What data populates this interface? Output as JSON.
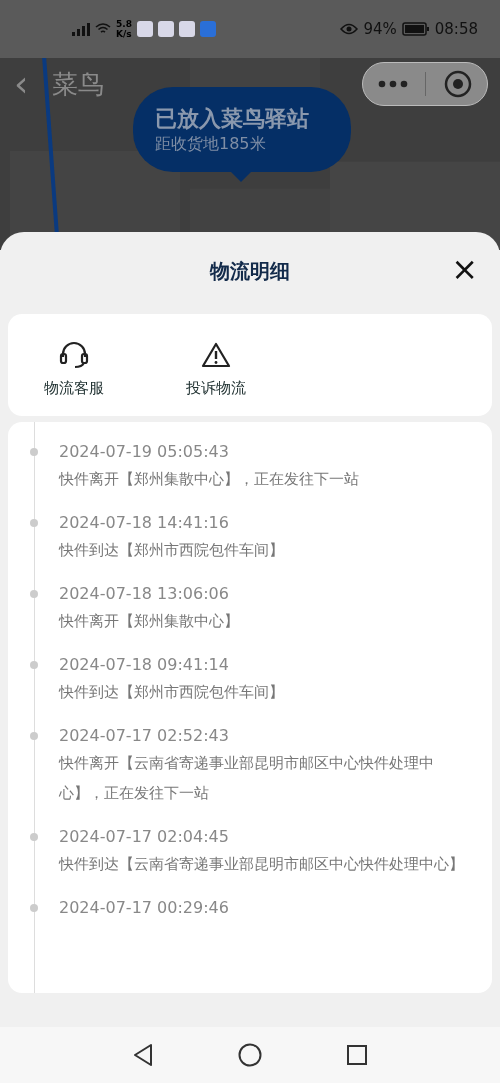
{
  "status_bar": {
    "speed": "5.8",
    "speed_unit": "K/s",
    "battery": "94%",
    "time": "08:58"
  },
  "map_header": {
    "back": "‹",
    "title": "菜鸟"
  },
  "bubble": {
    "title": "已放入菜鸟驿站",
    "subtitle": "距收货地185米"
  },
  "sheet": {
    "title": "物流明细",
    "close": "×"
  },
  "actions": [
    {
      "kind": "headset",
      "label": "物流客服"
    },
    {
      "kind": "warning",
      "label": "投诉物流"
    }
  ],
  "events": [
    {
      "time": "2024-07-19 05:05:43",
      "text": "快件离开【郑州集散中心】，正在发往下一站"
    },
    {
      "time": "2024-07-18 14:41:16",
      "text": "快件到达【郑州市西院包件车间】"
    },
    {
      "time": "2024-07-18 13:06:06",
      "text": "快件离开【郑州集散中心】"
    },
    {
      "time": "2024-07-18 09:41:14",
      "text": "快件到达【郑州市西院包件车间】"
    },
    {
      "time": "2024-07-17 02:52:43",
      "text": "快件离开【云南省寄递事业部昆明市邮区中心快件处理中心】，正在发往下一站"
    },
    {
      "time": "2024-07-17 02:04:45",
      "text": "快件到达【云南省寄递事业部昆明市邮区中心快件处理中心】"
    },
    {
      "time": "2024-07-17 00:29:46"
    }
  ]
}
